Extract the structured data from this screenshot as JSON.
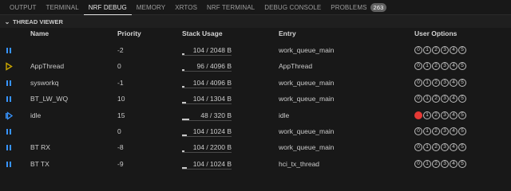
{
  "tabs": [
    {
      "label": "OUTPUT",
      "active": false
    },
    {
      "label": "TERMINAL",
      "active": false
    },
    {
      "label": "NRF DEBUG",
      "active": true
    },
    {
      "label": "MEMORY",
      "active": false
    },
    {
      "label": "XRTOS",
      "active": false
    },
    {
      "label": "NRF TERMINAL",
      "active": false
    },
    {
      "label": "DEBUG CONSOLE",
      "active": false
    },
    {
      "label": "PROBLEMS",
      "active": false,
      "badge": "263"
    }
  ],
  "section": {
    "title": "THREAD VIEWER",
    "icon": "chevron-down-icon"
  },
  "columns": {
    "name": "Name",
    "priority": "Priority",
    "stack": "Stack Usage",
    "entry": "Entry",
    "options": "User Options"
  },
  "options_labels": [
    "0",
    "1",
    "2",
    "3",
    "4",
    "5"
  ],
  "colors": {
    "accent_blue": "#3794ff",
    "accent_yellow": "#cca700",
    "option_on_red": "#e53935"
  },
  "threads": [
    {
      "state_icon": "pause-icon",
      "name": "",
      "priority": "-2",
      "stack_text": "104 / 2048 B",
      "stack_fraction": 0.05,
      "entry": "work_queue_main",
      "options_on": [
        false,
        false,
        false,
        false,
        false,
        false
      ]
    },
    {
      "state_icon": "play-outline-icon",
      "name": "AppThread",
      "priority": "0",
      "stack_text": "96 / 4096 B",
      "stack_fraction": 0.02,
      "entry": "AppThread",
      "options_on": [
        false,
        false,
        false,
        false,
        false,
        false
      ]
    },
    {
      "state_icon": "pause-icon",
      "name": "sysworkq",
      "priority": "-1",
      "stack_text": "104 / 4096 B",
      "stack_fraction": 0.03,
      "entry": "work_queue_main",
      "options_on": [
        false,
        false,
        false,
        false,
        false,
        false
      ]
    },
    {
      "state_icon": "pause-icon",
      "name": "BT_LW_WQ",
      "priority": "10",
      "stack_text": "104 / 1304 B",
      "stack_fraction": 0.08,
      "entry": "work_queue_main",
      "options_on": [
        false,
        false,
        false,
        false,
        false,
        false
      ]
    },
    {
      "state_icon": "step-play-icon",
      "name": "idle",
      "priority": "15",
      "stack_text": "48 / 320 B",
      "stack_fraction": 0.15,
      "entry": "idle",
      "options_on": [
        true,
        false,
        false,
        false,
        false,
        false
      ]
    },
    {
      "state_icon": "pause-icon",
      "name": "",
      "priority": "0",
      "stack_text": "104 / 1024 B",
      "stack_fraction": 0.1,
      "entry": "work_queue_main",
      "options_on": [
        false,
        false,
        false,
        false,
        false,
        false
      ]
    },
    {
      "state_icon": "pause-icon",
      "name": "BT RX",
      "priority": "-8",
      "stack_text": "104 / 2200 B",
      "stack_fraction": 0.05,
      "entry": "work_queue_main",
      "options_on": [
        false,
        false,
        false,
        false,
        false,
        false
      ]
    },
    {
      "state_icon": "pause-icon",
      "name": "BT TX",
      "priority": "-9",
      "stack_text": "104 / 1024 B",
      "stack_fraction": 0.1,
      "entry": "hci_tx_thread",
      "options_on": [
        false,
        false,
        false,
        false,
        false,
        false
      ]
    }
  ]
}
